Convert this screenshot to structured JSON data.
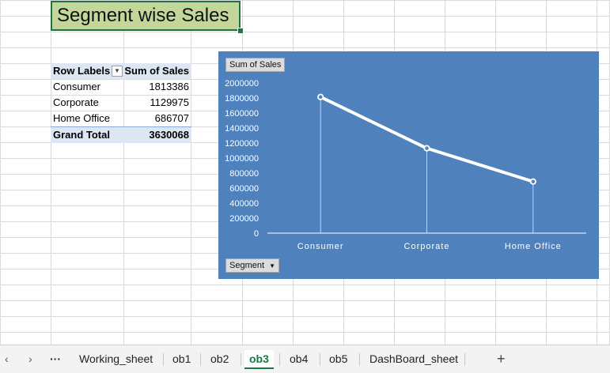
{
  "sheet": {
    "title": "Segment wise Sales"
  },
  "pivot": {
    "header_labels": "Row Labels",
    "header_values": "Sum of Sales",
    "rows": [
      {
        "label": "Consumer",
        "value": "1813386"
      },
      {
        "label": "Corporate",
        "value": "1129975"
      },
      {
        "label": "Home Office",
        "value": "686707"
      }
    ],
    "total_label": "Grand Total",
    "total_value": "3630068"
  },
  "chart_controls": {
    "value_button": "Sum of Sales",
    "axis_button": "Segment",
    "dropdown_glyph": "▼"
  },
  "chart_data": {
    "type": "line",
    "categories": [
      "Consumer",
      "Corporate",
      "Home Office"
    ],
    "series": [
      {
        "values": [
          1813386,
          1129975,
          686707
        ]
      }
    ],
    "yticks": [
      "2000000",
      "1800000",
      "1600000",
      "1400000",
      "1200000",
      "1000000",
      "800000",
      "600000",
      "400000",
      "200000",
      "0"
    ],
    "ylim": [
      0,
      2000000
    ],
    "title": "",
    "xlabel": "",
    "ylabel": "",
    "colors": {
      "background": "#4f81bd",
      "line": "#ffffff"
    }
  },
  "tabs": {
    "nav_prev": "‹",
    "nav_next": "›",
    "more": "···",
    "items": [
      "Working_sheet",
      "ob1",
      "ob2",
      "ob3",
      "ob4",
      "ob5",
      "DashBoard_sheet"
    ],
    "active": "ob3",
    "add": "+"
  }
}
